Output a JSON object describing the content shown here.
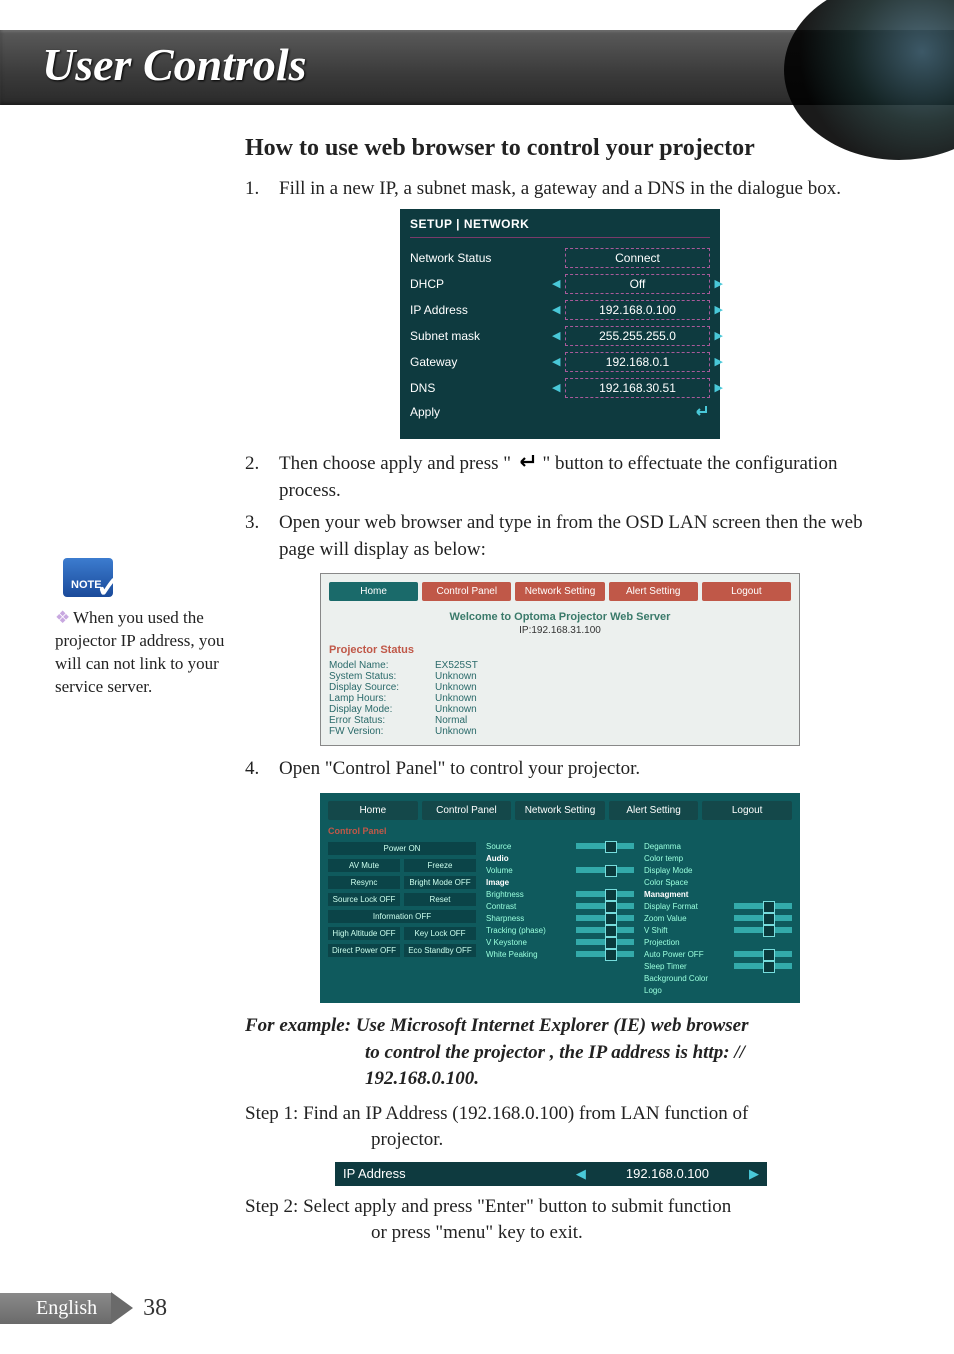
{
  "header": {
    "title": "User Controls"
  },
  "section_title": "How to use web browser to control your projector",
  "steps": {
    "s1": {
      "num": "1.",
      "text": "Fill in a new IP, a subnet mask, a gateway and a DNS in the dialogue box."
    },
    "s2": {
      "num": "2.",
      "pre": "Then choose apply and press \"",
      "post": "\" button to effectuate the configuration process."
    },
    "s3": {
      "num": "3.",
      "text": "Open your web browser and type in from the OSD LAN screen then the web page will display as below:"
    },
    "s4": {
      "num": "4.",
      "text": "Open \"Control Panel\" to control your projector."
    }
  },
  "osd": {
    "header": "SETUP | NETWORK",
    "rows": {
      "network_status": {
        "label": "Network Status",
        "value": "Connect"
      },
      "dhcp": {
        "label": "DHCP",
        "value": "Off"
      },
      "ip": {
        "label": "IP Address",
        "value": "192.168.0.100"
      },
      "subnet": {
        "label": "Subnet mask",
        "value": "255.255.255.0"
      },
      "gateway": {
        "label": "Gateway",
        "value": "192.168.0.1"
      },
      "dns": {
        "label": "DNS",
        "value": "192.168.30.51"
      },
      "apply": {
        "label": "Apply"
      }
    }
  },
  "web1": {
    "tabs": {
      "home": "Home",
      "cp": "Control Panel",
      "net": "Network Setting",
      "alert": "Alert Setting",
      "logout": "Logout"
    },
    "welcome": "Welcome to Optoma Projector Web Server",
    "ip": "IP:192.168.31.100",
    "ps_title": "Projector Status",
    "status": {
      "model": {
        "k": "Model Name:",
        "v": "EX525ST"
      },
      "sys": {
        "k": "System Status:",
        "v": "Unknown"
      },
      "src": {
        "k": "Display Source:",
        "v": "Unknown"
      },
      "lamp": {
        "k": "Lamp Hours:",
        "v": "Unknown"
      },
      "mode": {
        "k": "Display Mode:",
        "v": "Unknown"
      },
      "err": {
        "k": "Error Status:",
        "v": "Normal"
      },
      "fw": {
        "k": "FW Version:",
        "v": "Unknown"
      }
    }
  },
  "web2": {
    "tabs": {
      "home": "Home",
      "cp": "Control Panel",
      "net": "Network Setting",
      "alert": "Alert Setting",
      "logout": "Logout"
    },
    "title": "Control Panel",
    "left": {
      "power": "Power ON",
      "av": "AV Mute",
      "freeze": "Freeze",
      "resync": "Resync",
      "bright": "Bright Mode OFF",
      "srclock": "Source Lock OFF",
      "reset": "Reset",
      "info": "Information OFF",
      "alt": "High Altitude OFF",
      "key": "Key Lock OFF",
      "direct": "Direct Power OFF",
      "eco": "Eco Standby OFF"
    },
    "mid": {
      "source": "Source",
      "audio": "Audio",
      "volume": "Volume",
      "image": "Image",
      "brightness": "Brightness",
      "contrast": "Contrast",
      "sharpness": "Sharpness",
      "track": "Tracking (phase)",
      "vkey": "V Keystone",
      "wp": "White Peaking"
    },
    "right": {
      "degamma": "Degamma",
      "ctemp": "Color temp",
      "dmode": "Display Mode",
      "cspace": "Color Space",
      "mgmt": "Managment",
      "dfmt": "Display Format",
      "zoom": "Zoom Value",
      "vshift": "V Shift",
      "proj": "Projection",
      "apo": "Auto Power OFF",
      "sleep": "Sleep Timer",
      "bg": "Background Color",
      "logo": "Logo"
    }
  },
  "example": {
    "line1": "For example: Use Microsoft Internet Explorer (IE) web browser",
    "line2": "to control the projector , the IP address is http: //",
    "line3": "192.168.0.100."
  },
  "step1": {
    "label": "Step 1:",
    "l1": "Find an IP Address (192.168.0.100) from LAN function of",
    "l2": "projector."
  },
  "ipbar": {
    "label": "IP Address",
    "value": "192.168.0.100"
  },
  "step2": {
    "label": "Step 2:",
    "l1": "Select apply and press \"Enter\" button to submit function",
    "l2": "or press \"menu\" key to exit."
  },
  "note": {
    "badge": "NOTE",
    "bullet": "❖",
    "text": "When you used the projector IP address, you will can not link to your service server."
  },
  "footer": {
    "lang": "English",
    "page": "38"
  }
}
